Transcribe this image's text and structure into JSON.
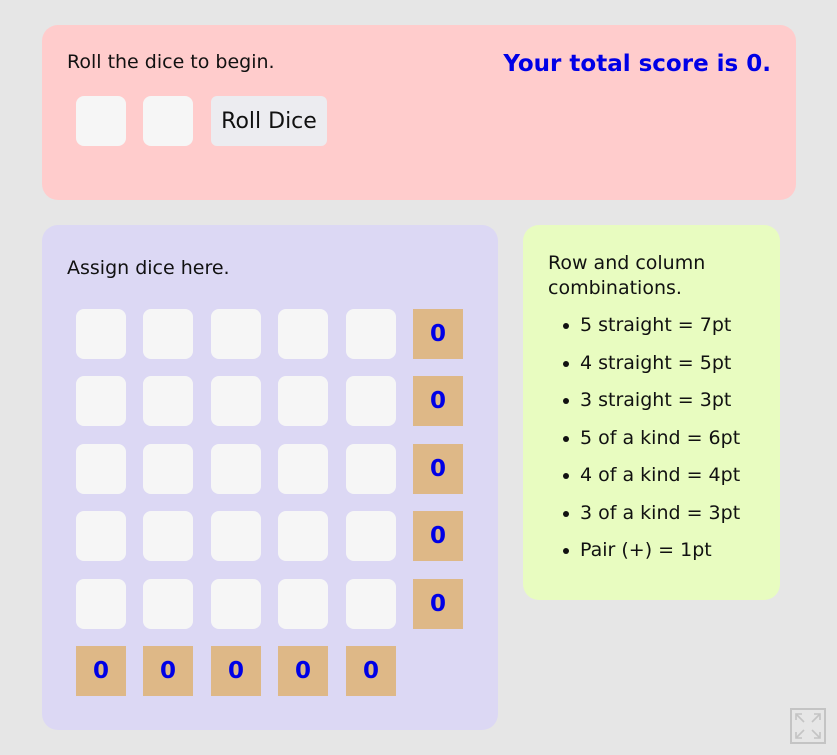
{
  "top": {
    "roll_message": "Roll the dice to begin.",
    "total_score_text": "Your total score is 0.",
    "roll_button_label": "Roll Dice"
  },
  "grid": {
    "assign_label": "Assign dice here.",
    "row_scores": [
      "0",
      "0",
      "0",
      "0",
      "0"
    ],
    "column_scores": [
      "0",
      "0",
      "0",
      "0",
      "0"
    ]
  },
  "rules": {
    "title": "Row and column combinations.",
    "items": [
      "5 straight = 7pt",
      "4 straight = 5pt",
      "3 straight = 3pt",
      "5 of a kind = 6pt",
      "4 of a kind = 4pt",
      "3 of a kind = 3pt",
      "Pair (+) = 1pt"
    ]
  },
  "colors": {
    "score_text": "#0000e6",
    "top_panel": "#ffcccc",
    "grid_panel": "#dcd8f4",
    "rules_panel": "#e8fcc0",
    "score_cell": "#deb887"
  },
  "icons": {
    "fullscreen": "fullscreen-icon"
  }
}
